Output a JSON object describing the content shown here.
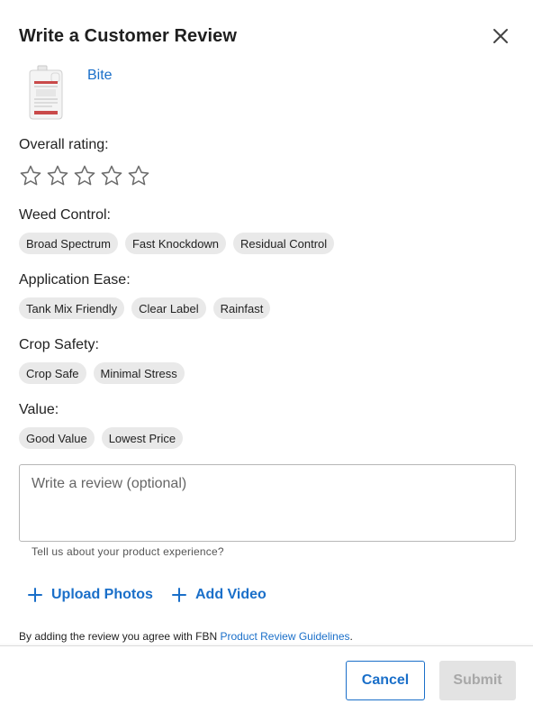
{
  "dialog": {
    "title": "Write a Customer Review"
  },
  "product": {
    "name": "Bite",
    "image_icon": "product-jug-image"
  },
  "rating": {
    "label": "Overall rating:",
    "max": 5,
    "value": 0
  },
  "categories": [
    {
      "label": "Weed Control:",
      "chips": [
        "Broad Spectrum",
        "Fast Knockdown",
        "Residual Control"
      ]
    },
    {
      "label": "Application Ease:",
      "chips": [
        "Tank Mix Friendly",
        "Clear Label",
        "Rainfast"
      ]
    },
    {
      "label": "Crop Safety:",
      "chips": [
        "Crop Safe",
        "Minimal Stress"
      ]
    },
    {
      "label": "Value:",
      "chips": [
        "Good Value",
        "Lowest Price"
      ]
    }
  ],
  "review": {
    "placeholder": "Write a review (optional)",
    "value": "",
    "helper": "Tell us about your product experience?"
  },
  "media": {
    "upload_photos": "Upload Photos",
    "add_video": "Add Video"
  },
  "agreement": {
    "text": "By adding the review you agree with FBN ",
    "link": "Product Review Guidelines",
    "suffix": "."
  },
  "footer": {
    "cancel": "Cancel",
    "submit": "Submit"
  },
  "colors": {
    "accent": "#1a6fc9",
    "chip_bg": "#e9e9e9",
    "disabled_bg": "#e3e3e3"
  }
}
